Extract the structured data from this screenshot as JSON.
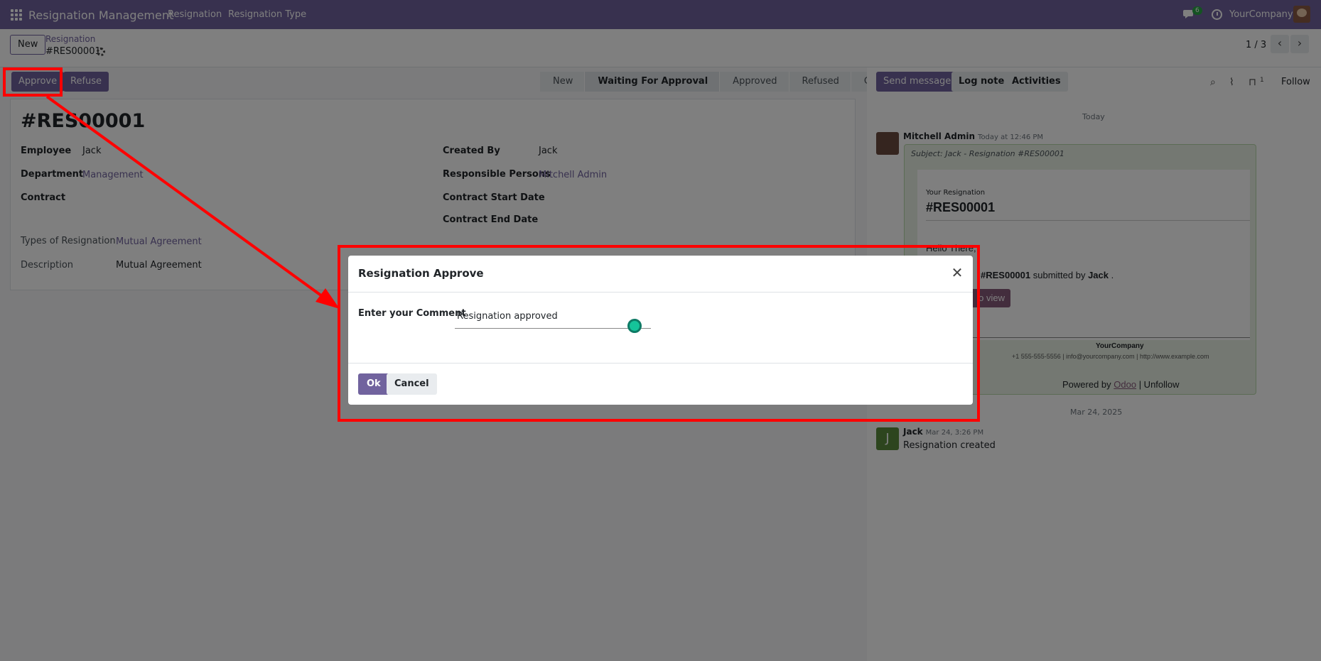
{
  "navbar": {
    "app_title": "Resignation Management",
    "menu": [
      "Resignation",
      "Resignation Type"
    ],
    "chat_count": "6",
    "company": "YourCompany"
  },
  "control_panel": {
    "new_label": "New",
    "breadcrumb_parent": "Resignation",
    "breadcrumb_current": "#RES00001",
    "pager": "1 / 3"
  },
  "form": {
    "actions": {
      "approve": "Approve",
      "refuse": "Refuse"
    },
    "stages": [
      "New",
      "Waiting For Approval",
      "Approved",
      "Refused",
      "Closed"
    ],
    "active_stage": "Waiting For Approval",
    "title": "#RES00001",
    "fields": {
      "employee_label": "Employee",
      "employee": "Jack",
      "department_label": "Department",
      "department": "Management",
      "contract_label": "Contract",
      "types_label": "Types of Resignation",
      "types": "Mutual Agreement",
      "description_label": "Description",
      "description": "Mutual Agreement",
      "created_by_label": "Created By",
      "created_by": "Jack",
      "responsible_label": "Responsible Persons",
      "responsible": "Mitchell Admin",
      "start_label": "Contract Start Date",
      "end_label": "Contract End Date"
    }
  },
  "chatter": {
    "send_message": "Send message",
    "log_note": "Log note",
    "activities": "Activities",
    "followers_count": "1",
    "follow": "Follow",
    "today": "Today",
    "msg1": {
      "author": "Mitchell Admin",
      "date": "Today at 12:46 PM",
      "subject": "Subject: Jack - Resignation #RES00001",
      "your_resignation": "Your Resignation",
      "ref": "#RES00001",
      "hello": "Hello There,",
      "line_prefix": "",
      "line_ref": "#RES00001",
      "line_mid": " submitted by ",
      "line_name": "Jack",
      "line_end": " .",
      "view_btn": "o view",
      "company": "YourCompany",
      "contact": "+1 555-555-5556 | info@yourcompany.com | http://www.example.com",
      "powered_prefix": "Powered by ",
      "powered_link": "Odoo",
      "powered_suffix": " | Unfollow"
    },
    "date_sep": "Mar 24, 2025",
    "msg2": {
      "author": "Jack",
      "avatar_letter": "J",
      "date": "Mar 24, 3:26 PM",
      "body": "Resignation created"
    }
  },
  "dialog": {
    "title": "Resignation Approve",
    "comment_label": "Enter your Comment",
    "comment_value": "Resignation approved",
    "ok": "Ok",
    "cancel": "Cancel"
  },
  "colors": {
    "brand": "#71639e",
    "annotation": "#ff0000"
  }
}
